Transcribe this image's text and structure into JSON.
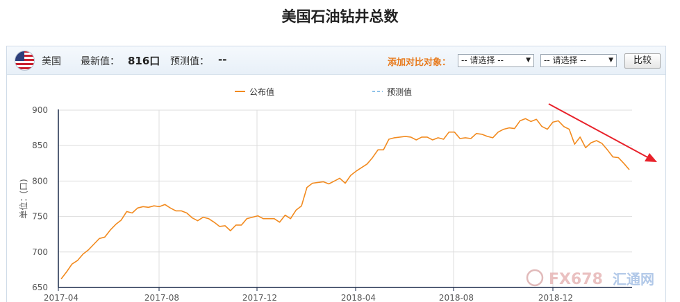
{
  "page": {
    "title": "美国石油钻井总数"
  },
  "toolbar": {
    "country": "美国",
    "latest_label": "最新值：",
    "latest_value": "816口",
    "forecast_label": "预测值：",
    "forecast_value": "--",
    "compare_label": "添加对比对象：",
    "select1": "-- 请选择 --",
    "select2": "-- 请选择 --",
    "compare_button": "比较"
  },
  "watermark": {
    "text": "FX678",
    "cn": "汇通网"
  },
  "colors": {
    "published": "#f28a1e",
    "forecast": "#8fc3ea",
    "trend_arrow": "#e8212a",
    "axis": "#1a2a4a",
    "grid": "#dddddd"
  },
  "chart_data": {
    "type": "line",
    "ylabel": "单位：(口)",
    "ylim": [
      650,
      900
    ],
    "yticks": [
      650,
      700,
      750,
      800,
      850,
      900
    ],
    "xticks": [
      "2017-04",
      "2017-08",
      "2017-12",
      "2018-04",
      "2018-08",
      "2018-12"
    ],
    "legend": [
      "公布值",
      "预测值"
    ],
    "grid": true,
    "series": [
      {
        "name": "公布值",
        "values": [
          662,
          672,
          683,
          688,
          697,
          703,
          711,
          719,
          721,
          731,
          739,
          745,
          757,
          755,
          762,
          764,
          763,
          765,
          764,
          767,
          762,
          758,
          758,
          755,
          748,
          744,
          749,
          747,
          742,
          736,
          737,
          730,
          738,
          738,
          747,
          749,
          751,
          747,
          747,
          747,
          742,
          752,
          747,
          759,
          765,
          791,
          797,
          798,
          799,
          796,
          800,
          804,
          797,
          808,
          814,
          819,
          824,
          833,
          844,
          844,
          859,
          861,
          862,
          863,
          862,
          858,
          862,
          862,
          858,
          861,
          859,
          869,
          869,
          860,
          861,
          860,
          867,
          866,
          863,
          861,
          869,
          873,
          875,
          874,
          885,
          888,
          884,
          887,
          877,
          873,
          883,
          885,
          877,
          873,
          852,
          862,
          847,
          854,
          857,
          853,
          844,
          834,
          833,
          825,
          816
        ]
      },
      {
        "name": "预测值",
        "values": []
      }
    ],
    "annotations": [
      {
        "type": "arrow",
        "description": "downtrend"
      }
    ]
  }
}
